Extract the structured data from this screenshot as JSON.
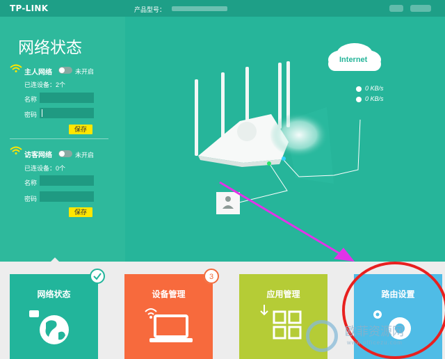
{
  "header": {
    "logo": "TP-LINK",
    "model_label": "产品型号："
  },
  "status_panel": {
    "title": "网络状态",
    "main_network": {
      "label": "主人网络",
      "toggle_state": "未开启",
      "devices": "已连设备：2个",
      "name_label": "名称",
      "password_label": "密码",
      "save_label": "保存"
    },
    "guest_network": {
      "label": "访客网络",
      "toggle_state": "未开启",
      "devices": "已连设备：0个",
      "name_label": "名称",
      "password_label": "密码",
      "save_label": "保存"
    }
  },
  "scene": {
    "cloud_label": "Internet",
    "upload_speed": "0 KB/s",
    "download_speed": "0 KB/s"
  },
  "tiles": [
    {
      "label": "网络状态",
      "color": "#22b59b",
      "icon": "globe-icon"
    },
    {
      "label": "设备管理",
      "color": "#f76a3d",
      "icon": "laptop-wifi-icon",
      "badge": "3"
    },
    {
      "label": "应用管理",
      "color": "#b5cc36",
      "icon": "apps-grid-icon"
    },
    {
      "label": "路由设置",
      "color": "#4fbce6",
      "icon": "gears-icon"
    }
  ],
  "watermark": {
    "text": "欧菲资源网",
    "url": "www.officezu.com"
  },
  "colors": {
    "teal": "#26b59a",
    "highlight_circle": "#e8201f",
    "arrow": "#e233e8",
    "save_button": "#ffe600"
  }
}
